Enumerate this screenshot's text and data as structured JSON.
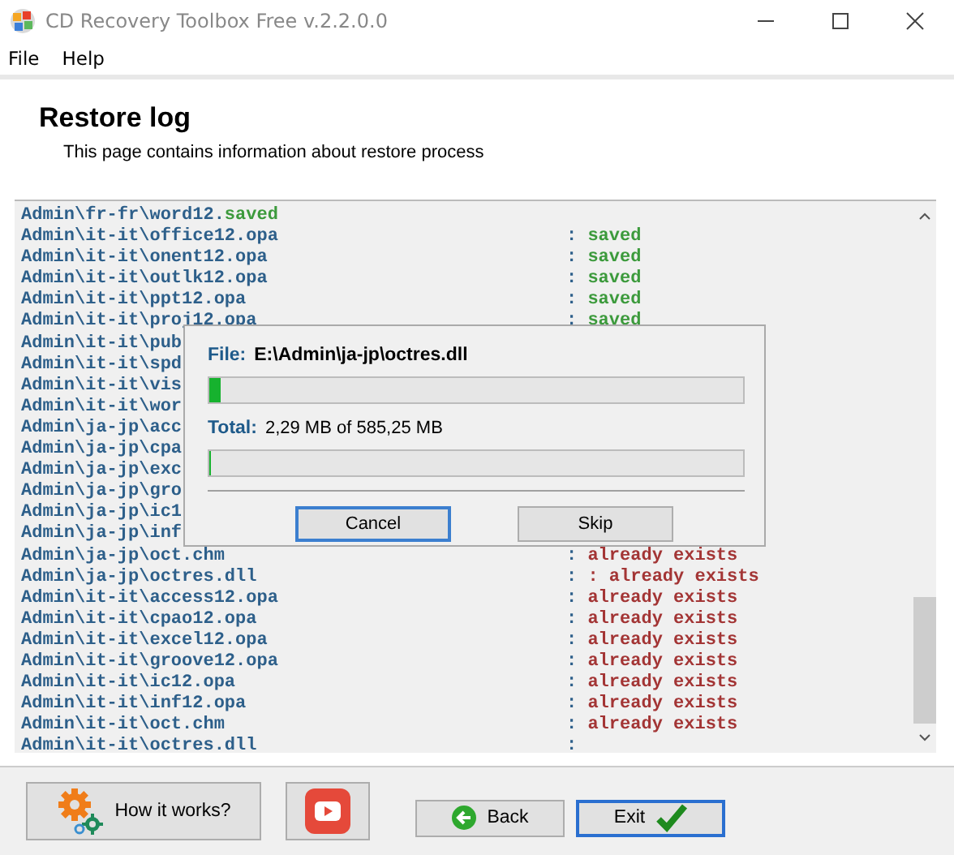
{
  "window": {
    "title": "CD Recovery Toolbox Free v.2.2.0.0"
  },
  "menu": [
    "File",
    "Help"
  ],
  "header": {
    "title": "Restore log",
    "subtitle": "This page contains information about restore process"
  },
  "log": [
    {
      "kind": "inline",
      "path": "Admin\\fr-fr\\word12.",
      "color": "#3c9a3c",
      "status": "saved"
    },
    {
      "kind": "row",
      "path": "Admin\\it-it\\office12.opa",
      "color": "#3c9a3c",
      "status": "saved"
    },
    {
      "kind": "row",
      "path": "Admin\\it-it\\onent12.opa",
      "color": "#3c9a3c",
      "status": "saved"
    },
    {
      "kind": "row",
      "path": "Admin\\it-it\\outlk12.opa",
      "color": "#3c9a3c",
      "status": "saved"
    },
    {
      "kind": "row",
      "path": "Admin\\it-it\\ppt12.opa",
      "color": "#3c9a3c",
      "status": "saved"
    },
    {
      "kind": "row",
      "path": "Admin\\it-it\\proj12.opa",
      "color": "#3c9a3c",
      "status": "saved"
    },
    {
      "kind": "hidden",
      "path": "Admin\\it-it\\pub"
    },
    {
      "kind": "hidden",
      "path": "Admin\\it-it\\spd"
    },
    {
      "kind": "hidden",
      "path": "Admin\\it-it\\vis"
    },
    {
      "kind": "hidden",
      "path": "Admin\\it-it\\wor"
    },
    {
      "kind": "hidden",
      "path": "Admin\\ja-jp\\acc"
    },
    {
      "kind": "hidden",
      "path": "Admin\\ja-jp\\cpa"
    },
    {
      "kind": "hidden",
      "path": "Admin\\ja-jp\\exc"
    },
    {
      "kind": "hidden",
      "path": "Admin\\ja-jp\\gro"
    },
    {
      "kind": "hidden",
      "path": "Admin\\ja-jp\\ic1"
    },
    {
      "kind": "hidden",
      "path": "Admin\\ja-jp\\inf"
    },
    {
      "kind": "row",
      "path": "Admin\\ja-jp\\oct.chm",
      "color": "#a33535",
      "status": "already exists"
    },
    {
      "kind": "row",
      "path": "Admin\\ja-jp\\octres.dll",
      "color": "#a33535",
      "status": ": already exists"
    },
    {
      "kind": "row",
      "path": "Admin\\it-it\\access12.opa",
      "color": "#a33535",
      "status": "already exists"
    },
    {
      "kind": "row",
      "path": "Admin\\it-it\\cpao12.opa",
      "color": "#a33535",
      "status": "already exists"
    },
    {
      "kind": "row",
      "path": "Admin\\it-it\\excel12.opa",
      "color": "#a33535",
      "status": "already exists"
    },
    {
      "kind": "row",
      "path": "Admin\\it-it\\groove12.opa",
      "color": "#a33535",
      "status": "already exists"
    },
    {
      "kind": "row",
      "path": "Admin\\it-it\\ic12.opa",
      "color": "#a33535",
      "status": "already exists"
    },
    {
      "kind": "row",
      "path": "Admin\\it-it\\inf12.opa",
      "color": "#a33535",
      "status": "already exists"
    },
    {
      "kind": "row",
      "path": "Admin\\it-it\\oct.chm",
      "color": "#a33535",
      "status": "already exists"
    },
    {
      "kind": "pending",
      "path": "Admin\\it-it\\octres.dll"
    }
  ],
  "separator": ":",
  "dialog": {
    "file_label": "File:",
    "file": "E:\\Admin\\ja-jp\\octres.dll",
    "file_progress": {
      "level": 0.02
    },
    "total_label": "Total:",
    "total": "2,29 MB of 585,25 MB",
    "total_progress": {
      "level": 0.004
    },
    "buttons": [
      "Cancel",
      "Skip"
    ]
  },
  "footer": {
    "how": "How it works?",
    "back": "Back",
    "exit": "Exit"
  }
}
